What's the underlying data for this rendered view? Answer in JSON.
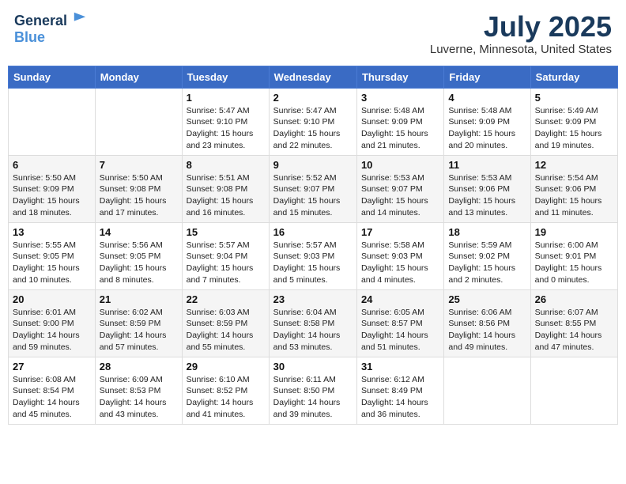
{
  "header": {
    "logo_line1": "General",
    "logo_line2": "Blue",
    "main_title": "July 2025",
    "subtitle": "Luverne, Minnesota, United States"
  },
  "weekdays": [
    "Sunday",
    "Monday",
    "Tuesday",
    "Wednesday",
    "Thursday",
    "Friday",
    "Saturday"
  ],
  "weeks": [
    [
      {
        "day": "",
        "info": ""
      },
      {
        "day": "",
        "info": ""
      },
      {
        "day": "1",
        "info": "Sunrise: 5:47 AM\nSunset: 9:10 PM\nDaylight: 15 hours\nand 23 minutes."
      },
      {
        "day": "2",
        "info": "Sunrise: 5:47 AM\nSunset: 9:10 PM\nDaylight: 15 hours\nand 22 minutes."
      },
      {
        "day": "3",
        "info": "Sunrise: 5:48 AM\nSunset: 9:09 PM\nDaylight: 15 hours\nand 21 minutes."
      },
      {
        "day": "4",
        "info": "Sunrise: 5:48 AM\nSunset: 9:09 PM\nDaylight: 15 hours\nand 20 minutes."
      },
      {
        "day": "5",
        "info": "Sunrise: 5:49 AM\nSunset: 9:09 PM\nDaylight: 15 hours\nand 19 minutes."
      }
    ],
    [
      {
        "day": "6",
        "info": "Sunrise: 5:50 AM\nSunset: 9:09 PM\nDaylight: 15 hours\nand 18 minutes."
      },
      {
        "day": "7",
        "info": "Sunrise: 5:50 AM\nSunset: 9:08 PM\nDaylight: 15 hours\nand 17 minutes."
      },
      {
        "day": "8",
        "info": "Sunrise: 5:51 AM\nSunset: 9:08 PM\nDaylight: 15 hours\nand 16 minutes."
      },
      {
        "day": "9",
        "info": "Sunrise: 5:52 AM\nSunset: 9:07 PM\nDaylight: 15 hours\nand 15 minutes."
      },
      {
        "day": "10",
        "info": "Sunrise: 5:53 AM\nSunset: 9:07 PM\nDaylight: 15 hours\nand 14 minutes."
      },
      {
        "day": "11",
        "info": "Sunrise: 5:53 AM\nSunset: 9:06 PM\nDaylight: 15 hours\nand 13 minutes."
      },
      {
        "day": "12",
        "info": "Sunrise: 5:54 AM\nSunset: 9:06 PM\nDaylight: 15 hours\nand 11 minutes."
      }
    ],
    [
      {
        "day": "13",
        "info": "Sunrise: 5:55 AM\nSunset: 9:05 PM\nDaylight: 15 hours\nand 10 minutes."
      },
      {
        "day": "14",
        "info": "Sunrise: 5:56 AM\nSunset: 9:05 PM\nDaylight: 15 hours\nand 8 minutes."
      },
      {
        "day": "15",
        "info": "Sunrise: 5:57 AM\nSunset: 9:04 PM\nDaylight: 15 hours\nand 7 minutes."
      },
      {
        "day": "16",
        "info": "Sunrise: 5:57 AM\nSunset: 9:03 PM\nDaylight: 15 hours\nand 5 minutes."
      },
      {
        "day": "17",
        "info": "Sunrise: 5:58 AM\nSunset: 9:03 PM\nDaylight: 15 hours\nand 4 minutes."
      },
      {
        "day": "18",
        "info": "Sunrise: 5:59 AM\nSunset: 9:02 PM\nDaylight: 15 hours\nand 2 minutes."
      },
      {
        "day": "19",
        "info": "Sunrise: 6:00 AM\nSunset: 9:01 PM\nDaylight: 15 hours\nand 0 minutes."
      }
    ],
    [
      {
        "day": "20",
        "info": "Sunrise: 6:01 AM\nSunset: 9:00 PM\nDaylight: 14 hours\nand 59 minutes."
      },
      {
        "day": "21",
        "info": "Sunrise: 6:02 AM\nSunset: 8:59 PM\nDaylight: 14 hours\nand 57 minutes."
      },
      {
        "day": "22",
        "info": "Sunrise: 6:03 AM\nSunset: 8:59 PM\nDaylight: 14 hours\nand 55 minutes."
      },
      {
        "day": "23",
        "info": "Sunrise: 6:04 AM\nSunset: 8:58 PM\nDaylight: 14 hours\nand 53 minutes."
      },
      {
        "day": "24",
        "info": "Sunrise: 6:05 AM\nSunset: 8:57 PM\nDaylight: 14 hours\nand 51 minutes."
      },
      {
        "day": "25",
        "info": "Sunrise: 6:06 AM\nSunset: 8:56 PM\nDaylight: 14 hours\nand 49 minutes."
      },
      {
        "day": "26",
        "info": "Sunrise: 6:07 AM\nSunset: 8:55 PM\nDaylight: 14 hours\nand 47 minutes."
      }
    ],
    [
      {
        "day": "27",
        "info": "Sunrise: 6:08 AM\nSunset: 8:54 PM\nDaylight: 14 hours\nand 45 minutes."
      },
      {
        "day": "28",
        "info": "Sunrise: 6:09 AM\nSunset: 8:53 PM\nDaylight: 14 hours\nand 43 minutes."
      },
      {
        "day": "29",
        "info": "Sunrise: 6:10 AM\nSunset: 8:52 PM\nDaylight: 14 hours\nand 41 minutes."
      },
      {
        "day": "30",
        "info": "Sunrise: 6:11 AM\nSunset: 8:50 PM\nDaylight: 14 hours\nand 39 minutes."
      },
      {
        "day": "31",
        "info": "Sunrise: 6:12 AM\nSunset: 8:49 PM\nDaylight: 14 hours\nand 36 minutes."
      },
      {
        "day": "",
        "info": ""
      },
      {
        "day": "",
        "info": ""
      }
    ]
  ]
}
